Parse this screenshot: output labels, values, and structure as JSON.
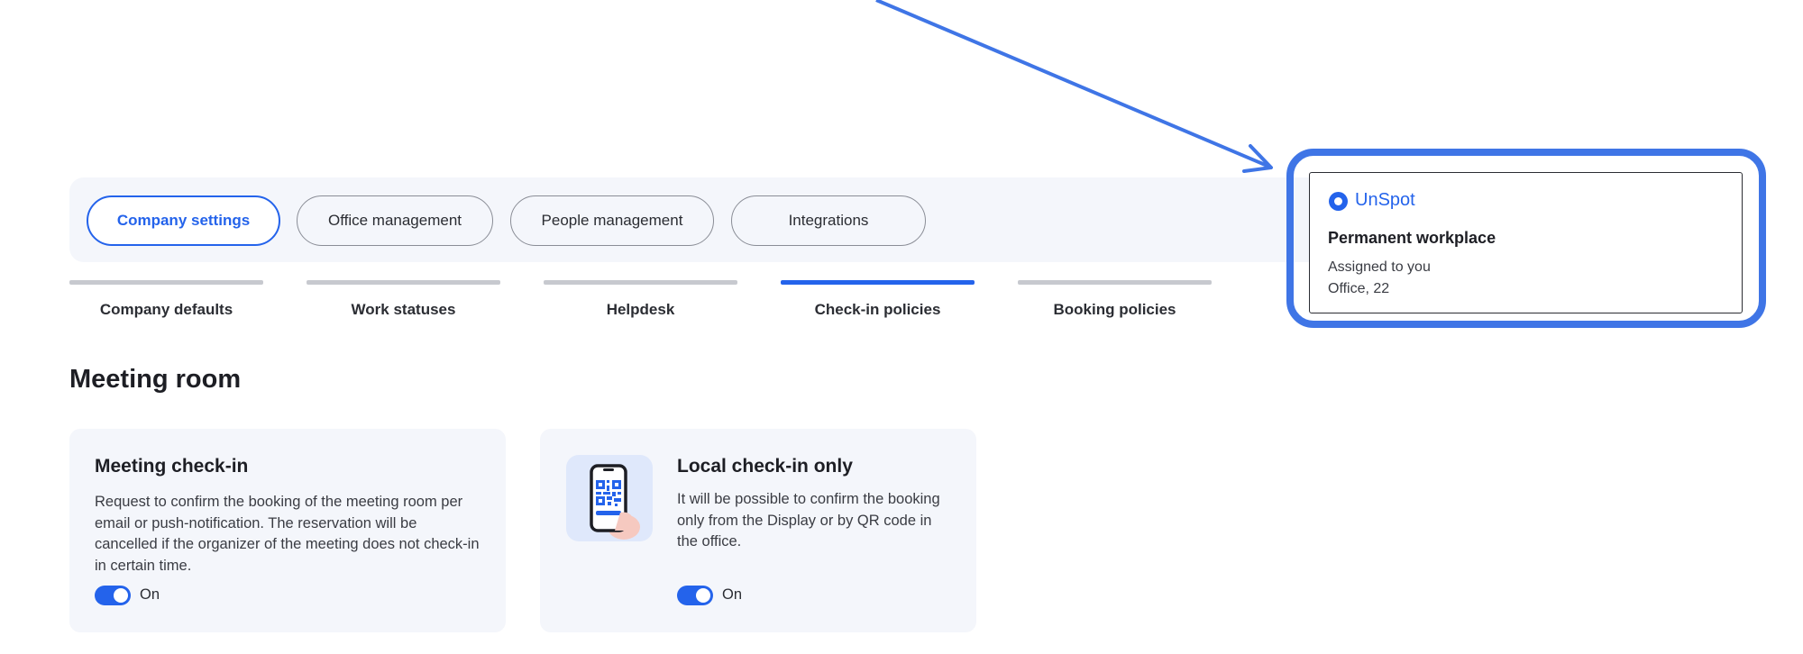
{
  "top_tabs": [
    {
      "label": "Company settings",
      "active": true
    },
    {
      "label": "Office management",
      "active": false
    },
    {
      "label": "People management",
      "active": false
    },
    {
      "label": "Integrations",
      "active": false
    }
  ],
  "sub_tabs": [
    {
      "label": "Company defaults",
      "active": false
    },
    {
      "label": "Work statuses",
      "active": false
    },
    {
      "label": "Helpdesk",
      "active": false
    },
    {
      "label": "Check-in policies",
      "active": true
    },
    {
      "label": "Booking policies",
      "active": false
    }
  ],
  "section": {
    "title": "Meeting room"
  },
  "cards": [
    {
      "title": "Meeting check-in",
      "description": "Request to confirm the booking of the meeting room per email or push-notification. The reservation will be cancelled if the organizer of the meeting does not check-in in certain time.",
      "toggle_label": "On",
      "toggle_on": true
    },
    {
      "title": "Local check-in only",
      "description": "It will be possible to confirm the booking only from the Display or by QR code in the office.",
      "toggle_label": "On",
      "toggle_on": true,
      "icon": "phone-qr-icon"
    }
  ],
  "popover": {
    "brand": "UnSpot",
    "title": "Permanent workplace",
    "line1": "Assigned to you",
    "line2": "Office, 22"
  },
  "colors": {
    "accent": "#2463eb",
    "annotation": "#3f75e6",
    "panel": "#f4f6fb"
  }
}
